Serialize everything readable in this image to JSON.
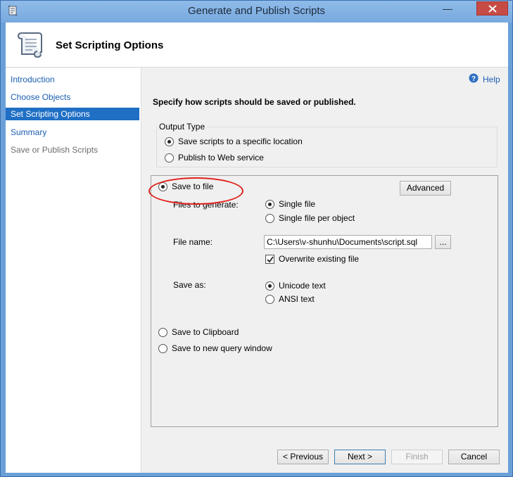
{
  "window": {
    "title": "Generate and Publish Scripts",
    "minimize_glyph": "—",
    "close_icon": "close-icon"
  },
  "header": {
    "title": "Set Scripting Options",
    "icon": "scroll-icon"
  },
  "nav": {
    "items": [
      {
        "label": "Introduction",
        "state": "link"
      },
      {
        "label": "Choose Objects",
        "state": "link"
      },
      {
        "label": "Set Scripting Options",
        "state": "active"
      },
      {
        "label": "Summary",
        "state": "link"
      },
      {
        "label": "Save or Publish Scripts",
        "state": "disabled"
      }
    ]
  },
  "help": {
    "label": "Help",
    "icon": "help-icon"
  },
  "content": {
    "instruction": "Specify how scripts should be saved or published."
  },
  "output_type": {
    "legend": "Output Type",
    "options": [
      {
        "label": "Save scripts to a specific location",
        "selected": true
      },
      {
        "label": "Publish to Web service",
        "selected": false
      }
    ]
  },
  "save_panel": {
    "save_to_file": {
      "label": "Save to file",
      "selected": true
    },
    "advanced_label": "Advanced",
    "files_to_generate": {
      "label": "Files to generate:",
      "options": [
        {
          "label": "Single file",
          "selected": true
        },
        {
          "label": "Single file per object",
          "selected": false
        }
      ]
    },
    "file_name": {
      "label": "File name:",
      "value": "C:\\Users\\v-shunhu\\Documents\\script.sql",
      "browse_label": "..."
    },
    "overwrite": {
      "label": "Overwrite existing file",
      "checked": true
    },
    "save_as": {
      "label": "Save as:",
      "options": [
        {
          "label": "Unicode text",
          "selected": true
        },
        {
          "label": "ANSI text",
          "selected": false
        }
      ]
    },
    "save_to_clipboard": {
      "label": "Save to Clipboard",
      "selected": false
    },
    "save_to_query_window": {
      "label": "Save to new query window",
      "selected": false
    }
  },
  "footer": {
    "previous_label": "< Previous",
    "next_label": "Next >",
    "finish_label": "Finish",
    "cancel_label": "Cancel"
  },
  "colors": {
    "annotation": "#e0201b",
    "nav_active": "#1f6fc5",
    "link": "#1c5fb4"
  }
}
